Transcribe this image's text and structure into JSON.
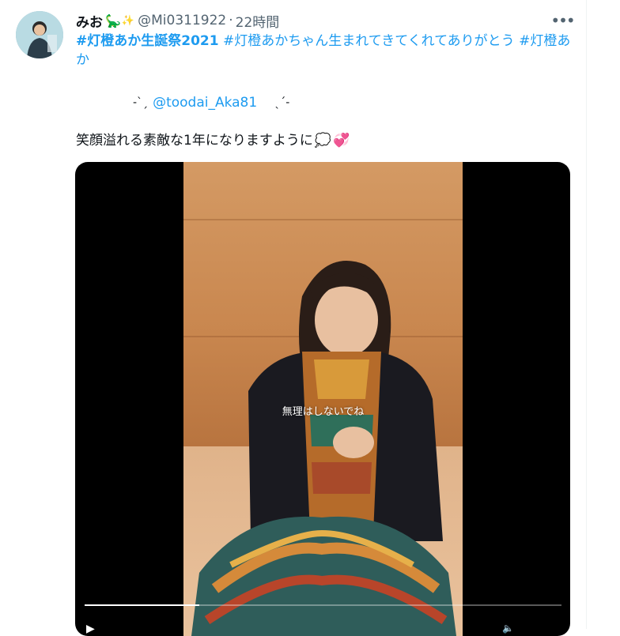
{
  "tweet": {
    "display_name": "みお",
    "name_emoji": "🦕",
    "name_sparkle": "✨",
    "handle": "@Mi0311922",
    "separator": "·",
    "time": "22時間",
    "more_icon": "more-horizontal-icon",
    "hashtags": [
      "#灯橙あか生誕祭2021",
      "#灯橙あかちゃん生まれてきてくれてありがとう",
      "#灯橙あか"
    ],
    "mention_deco_left": "-ˋˏ",
    "mention": "@toodai_Aka81",
    "mention_deco_right": "ˎˊ-",
    "wish_text": "笑顔溢れる素敵な1年になりますように",
    "wish_emoji_1": "💭",
    "wish_emoji_2": "💞"
  },
  "video": {
    "subtitle": "無理はしないでね",
    "progress": 0.24,
    "play_icon": "play-icon",
    "volume_icon": "volume-icon"
  },
  "colors": {
    "accent": "#1d9bf0",
    "text": "#0f1419",
    "muted": "#536471"
  }
}
